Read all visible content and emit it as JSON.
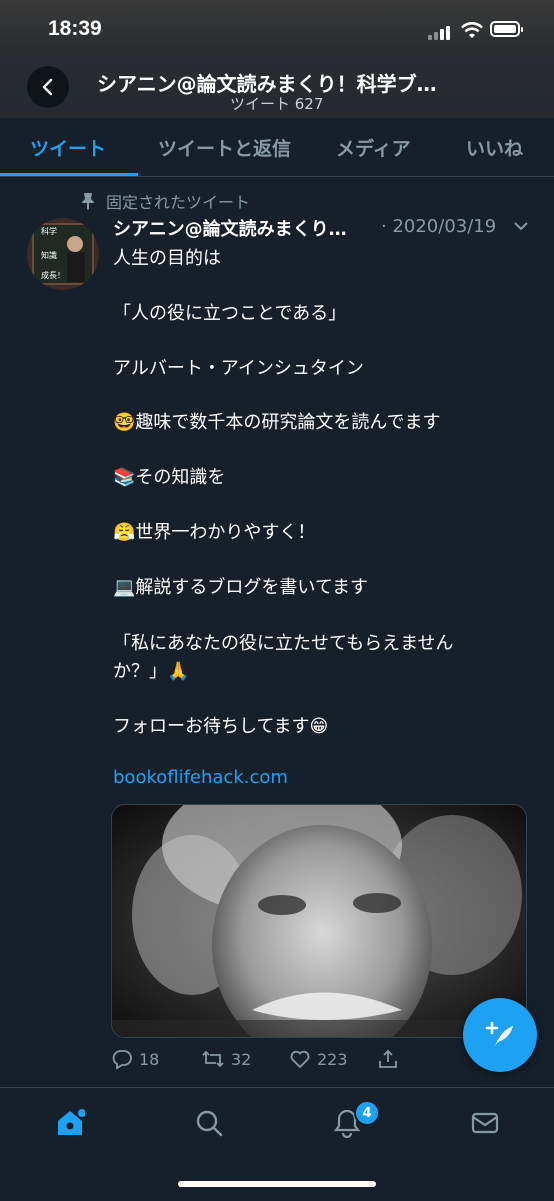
{
  "status": {
    "time": "18:39"
  },
  "header": {
    "title": "シアニン@論文読みまくり！科学ブ…",
    "subtitle": "ツイート 627"
  },
  "tabs": [
    {
      "label": "ツイート",
      "active": true
    },
    {
      "label": "ツイートと返信",
      "active": false
    },
    {
      "label": "メディア",
      "active": false
    },
    {
      "label": "いいね",
      "active": false
    }
  ],
  "tweet": {
    "pinned_label": "固定されたツイート",
    "author": "シアニン@論文読みまくり…",
    "date": "· 2020/03/19",
    "avatar_text": [
      "科学",
      "知識",
      "成長！"
    ],
    "lines": [
      "人生の目的は",
      "「人の役に立つことである」",
      "アルバート・アインシュタイン",
      "🤓趣味で数千本の研究論文を読んでます",
      "📚その知識を",
      "😤世界一わかりやすく！",
      "💻解説するブログを書いてます",
      "「私にあなたの役に立たせてもらえません",
      "か？」🙏",
      "フォローお待ちしてます😁"
    ],
    "link": "bookoflifehack.com",
    "replies": "18",
    "retweets": "32",
    "likes": "223"
  },
  "notifications_badge": "4",
  "colors": {
    "background": "#15202b",
    "accent": "#1da1f2",
    "muted": "#8899a6"
  }
}
